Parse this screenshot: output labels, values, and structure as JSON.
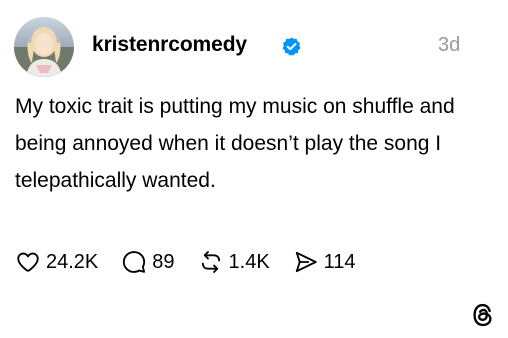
{
  "post": {
    "author": {
      "username": "kristenrcomedy",
      "verified": true
    },
    "timestamp": "3d",
    "text": "My toxic trait is putting my music on shuffle and being annoyed when it doesn’t play the song I telepathically wanted.",
    "stats": {
      "likes": "24.2K",
      "replies": "89",
      "reposts": "1.4K",
      "shares": "114"
    }
  },
  "icons": {
    "verified": "verified-badge-icon",
    "like": "heart-icon",
    "reply": "speech-bubble-icon",
    "repost": "repost-arrows-icon",
    "share": "send-paper-plane-icon",
    "logo": "threads-logo-icon"
  },
  "colors": {
    "verified_badge": "#0095F6",
    "timestamp": "#999999",
    "text": "#000000",
    "background": "#FFFFFF"
  }
}
